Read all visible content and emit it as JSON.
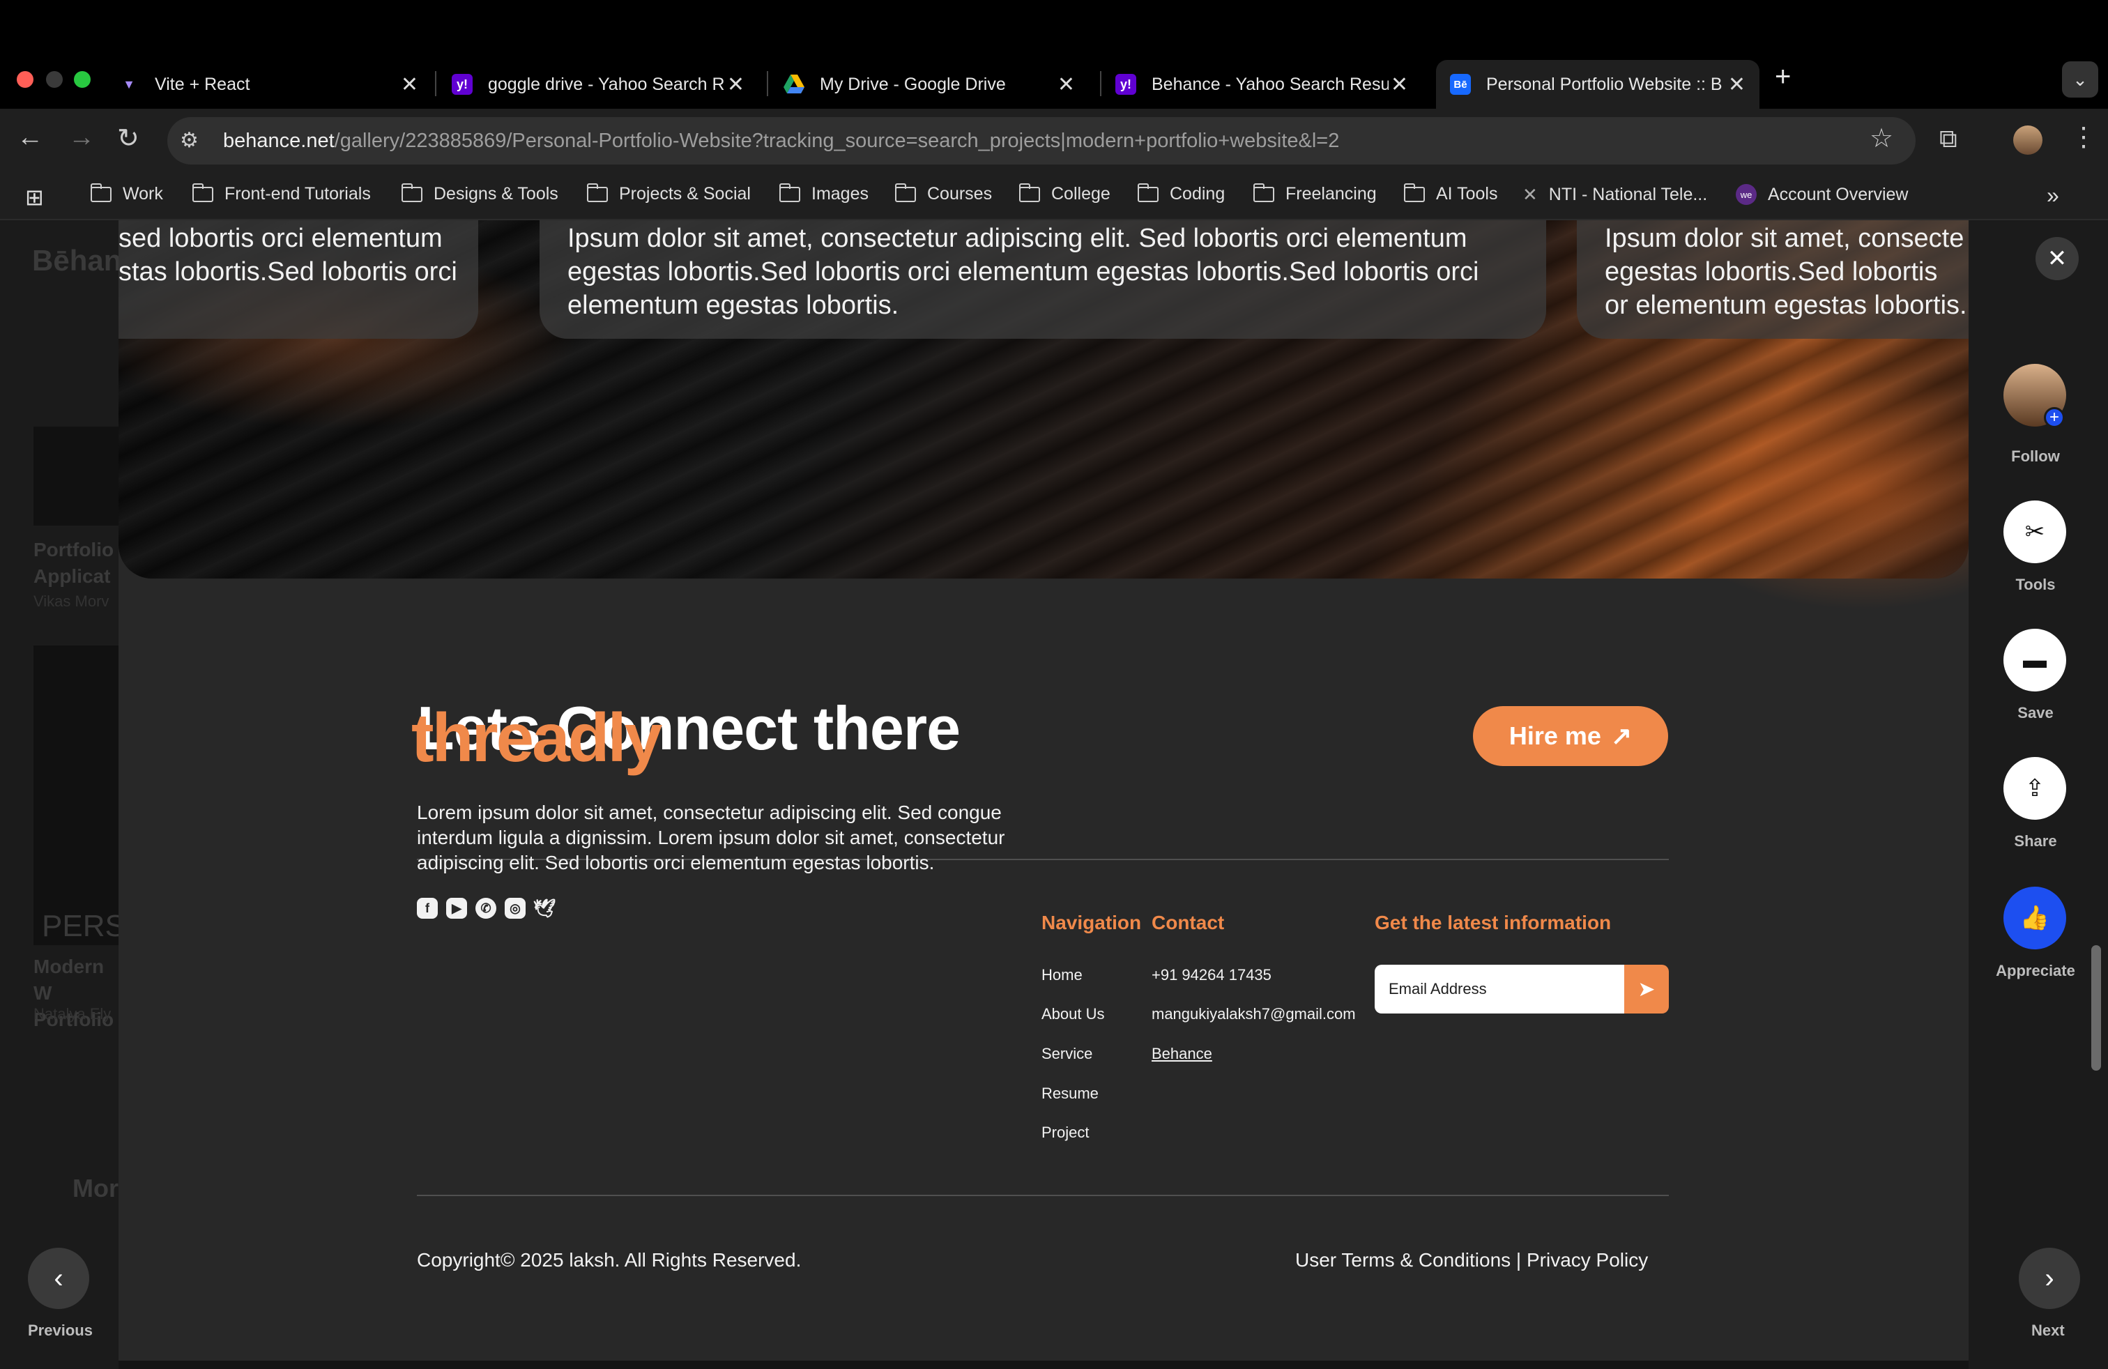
{
  "browser": {
    "tabs": [
      {
        "label": "Vite + React",
        "favicon": "vite-icon",
        "close": "✕"
      },
      {
        "label": "goggle drive - Yahoo Search R",
        "favicon": "yahoo-icon",
        "close": "✕"
      },
      {
        "label": "My Drive - Google Drive",
        "favicon": "google-drive-icon",
        "close": "✕"
      },
      {
        "label": "Behance - Yahoo Search Resu",
        "favicon": "yahoo-icon",
        "close": "✕"
      },
      {
        "label": "Personal Portfolio Website :: B",
        "favicon": "behance-icon",
        "close": "✕",
        "active": true
      }
    ],
    "new_tab": "+",
    "url_host": "behance.net",
    "url_path": "/gallery/223885869/Personal-Portfolio-Website?tracking_source=search_projects|modern+portfolio+website&l=2",
    "bookmarks": [
      {
        "label": "Work"
      },
      {
        "label": "Front-end Tutorials"
      },
      {
        "label": "Designs & Tools"
      },
      {
        "label": "Projects & Social"
      },
      {
        "label": "Images"
      },
      {
        "label": "Courses"
      },
      {
        "label": "College"
      },
      {
        "label": "Coding"
      },
      {
        "label": "Freelancing"
      },
      {
        "label": "AI Tools"
      },
      {
        "label": "NTI - National Tele..."
      },
      {
        "label": "Account Overview"
      }
    ]
  },
  "background": {
    "logo": "Bēhance",
    "card1_title": "Portfolio Applicat",
    "card1_author": "Vikas Morv",
    "card2_title": "Modern W Portfolio",
    "card2_author": "Natalya Ely",
    "card2_img_text": "PERS",
    "more_heading": "Mor"
  },
  "hero": {
    "card_left": "sed lobortis orci elementum stas lobortis.Sed lobortis orci",
    "card_center": "Ipsum dolor sit amet, consectetur adipiscing elit. Sed lobortis orci elementum egestas lobortis.Sed lobortis orci elementum egestas lobortis.Sed lobortis orci elementum egestas lobortis.",
    "card_right": "Ipsum dolor sit amet, consecte egestas lobortis.Sed lobortis or elementum egestas lobortis."
  },
  "connect": {
    "title": "Lets Connect there",
    "hire_label": "Hire me"
  },
  "footer": {
    "brand": "threadly",
    "about": "Lorem ipsum dolor sit amet, consectetur adipiscing elit. Sed congue interdum ligula a dignissim. Lorem ipsum dolor sit amet, consectetur adipiscing elit. Sed lobortis orci elementum egestas lobortis.",
    "navigation_heading": "Navigation",
    "navigation": [
      "Home",
      "About Us",
      "Service",
      "Resume",
      "Project"
    ],
    "contact_heading": "Contact",
    "contact": [
      "+91 94264 17435",
      "mangukiyalaksh7@gmail.com",
      "Behance"
    ],
    "newsletter_heading": "Get the latest information",
    "email_placeholder": "Email Address",
    "copyright": "Copyright© 2025 laksh. All Rights Reserved.",
    "legal": "User Terms & Conditions | Privacy Policy"
  },
  "rail": {
    "follow": "Follow",
    "tools": "Tools",
    "save": "Save",
    "share": "Share",
    "appreciate": "Appreciate"
  },
  "pager": {
    "previous": "Previous",
    "next": "Next"
  },
  "colors": {
    "accent": "#f0894a",
    "modal_bg": "#282828",
    "appreciate_blue": "#1d4ff0"
  }
}
